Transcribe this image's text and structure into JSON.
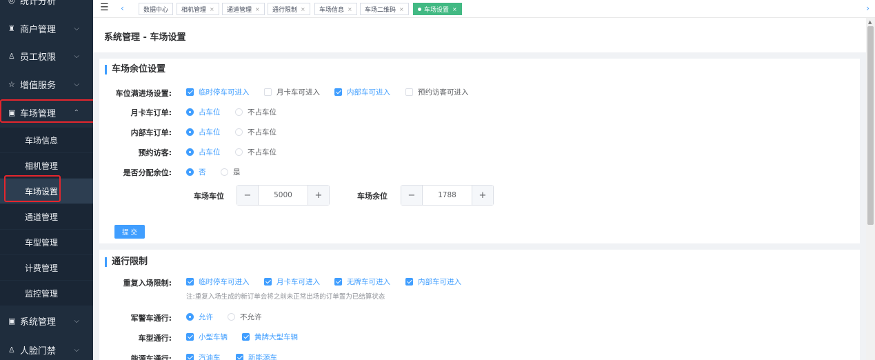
{
  "sidebar": {
    "items": [
      {
        "label": "统计分析",
        "icon": "chart-icon"
      },
      {
        "label": "商户管理",
        "icon": "merchant-icon"
      },
      {
        "label": "员工权限",
        "icon": "users-icon"
      },
      {
        "label": "增值服务",
        "icon": "star-icon"
      },
      {
        "label": "车场管理",
        "icon": "parking-icon"
      },
      {
        "label": "系统管理",
        "icon": "system-icon"
      },
      {
        "label": "人脸门禁",
        "icon": "face-icon"
      }
    ],
    "sub_items": [
      {
        "label": "车场信息"
      },
      {
        "label": "相机管理"
      },
      {
        "label": "车场设置"
      },
      {
        "label": "通道管理"
      },
      {
        "label": "车型管理"
      },
      {
        "label": "计费管理"
      },
      {
        "label": "监控管理"
      }
    ]
  },
  "tabs": [
    {
      "label": "数据中心"
    },
    {
      "label": "相机管理"
    },
    {
      "label": "通道管理"
    },
    {
      "label": "通行限制"
    },
    {
      "label": "车场信息"
    },
    {
      "label": "车场二维码"
    },
    {
      "label": "车场设置"
    }
  ],
  "page": {
    "title": "系统管理 - 车场设置"
  },
  "space_section": {
    "title": "车场余位设置",
    "full_entry": {
      "label": "车位满进场设置:",
      "options": [
        {
          "label": "临时停车可进入",
          "checked": true
        },
        {
          "label": "月卡车可进入",
          "checked": false
        },
        {
          "label": "内部车可进入",
          "checked": true
        },
        {
          "label": "预约访客可进入",
          "checked": false
        }
      ]
    },
    "monthly_order": {
      "label": "月卡车订单:",
      "opt_a": "占车位",
      "opt_b": "不占车位"
    },
    "internal_order": {
      "label": "内部车订单:",
      "opt_a": "占车位",
      "opt_b": "不占车位"
    },
    "visitor": {
      "label": "预约访客:",
      "opt_a": "占车位",
      "opt_b": "不占车位"
    },
    "allocate": {
      "label": "是否分配余位:",
      "opt_a": "否",
      "opt_b": "是"
    },
    "spaces": {
      "label": "车场车位",
      "value": "5000"
    },
    "remaining": {
      "label": "车场余位",
      "value": "1788"
    },
    "submit": "提 交"
  },
  "pass_section": {
    "title": "通行限制",
    "reentry": {
      "label": "重复入场限制:",
      "options": [
        {
          "label": "临时停车可进入",
          "checked": true
        },
        {
          "label": "月卡车可进入",
          "checked": true
        },
        {
          "label": "无牌车可进入",
          "checked": true
        },
        {
          "label": "内部车可进入",
          "checked": true
        }
      ],
      "note": "注:重复入场生成的新订单会将之前未正常出场的订单置为已结算状态"
    },
    "military": {
      "label": "军警车通行:",
      "opt_a": "允许",
      "opt_b": "不允许"
    },
    "vehicle_type": {
      "label": "车型通行:",
      "opt_a": "小型车辆",
      "opt_b": "黄牌大型车辆"
    },
    "energy": {
      "label": "能源车通行:",
      "opt_a": "汽油车",
      "opt_b": "新能源车"
    }
  }
}
